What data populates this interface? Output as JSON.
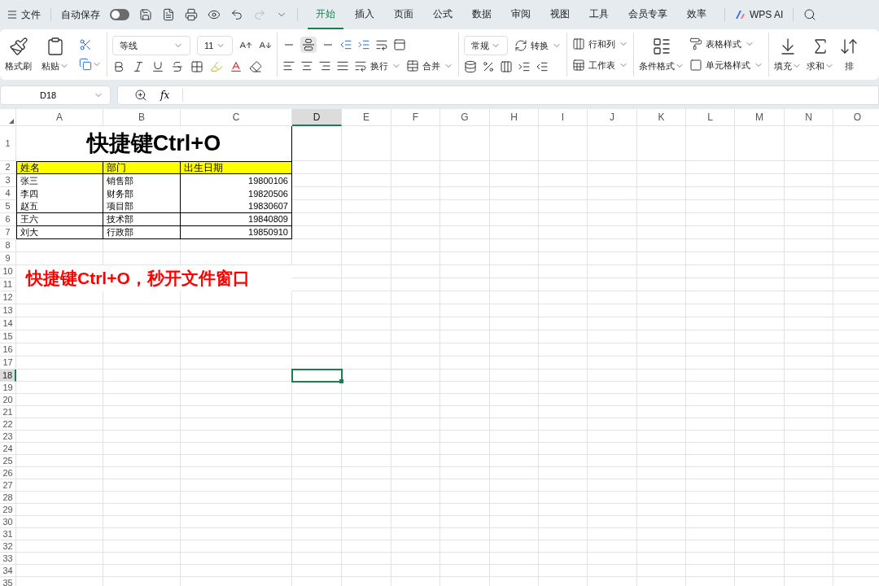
{
  "title_bar": {
    "file_menu": "文件",
    "autosave": {
      "label": "自动保存",
      "on": false
    },
    "tabs": [
      {
        "label": "开始",
        "selected": true
      },
      {
        "label": "插入",
        "selected": false
      },
      {
        "label": "页面",
        "selected": false
      },
      {
        "label": "公式",
        "selected": false
      },
      {
        "label": "数据",
        "selected": false
      },
      {
        "label": "审阅",
        "selected": false
      },
      {
        "label": "视图",
        "selected": false
      },
      {
        "label": "工具",
        "selected": false
      },
      {
        "label": "会员专享",
        "selected": false
      },
      {
        "label": "效率",
        "selected": false
      }
    ],
    "ai_button": "WPS AI"
  },
  "ribbon": {
    "format_painter": "格式刷",
    "paste": "粘贴",
    "font": "等线",
    "font_size": "11",
    "wrap": "换行",
    "merge": "合并",
    "number_format": "常规",
    "convert": "转换",
    "rows_cols": "行和列",
    "worksheet": "工作表",
    "conditional": "条件格式",
    "table_style": "表格样式",
    "cell_style": "单元格样式",
    "fill": "填充",
    "sum": "求和",
    "sort": "排"
  },
  "formula_bar": {
    "cell_name": "D18",
    "fx": "fx"
  },
  "columns": [
    {
      "label": "A",
      "selected": false
    },
    {
      "label": "B",
      "selected": false
    },
    {
      "label": "C",
      "selected": false
    },
    {
      "label": "D",
      "selected": true
    },
    {
      "label": "E",
      "selected": false
    },
    {
      "label": "F",
      "selected": false
    },
    {
      "label": "G",
      "selected": false
    },
    {
      "label": "H",
      "selected": false
    },
    {
      "label": "I",
      "selected": false
    },
    {
      "label": "J",
      "selected": false
    },
    {
      "label": "K",
      "selected": false
    },
    {
      "label": "L",
      "selected": false
    },
    {
      "label": "M",
      "selected": false
    },
    {
      "label": "N",
      "selected": false
    },
    {
      "label": "O",
      "selected": false
    }
  ],
  "rows": [
    {
      "label": "1",
      "selected": false
    },
    {
      "label": "2",
      "selected": false
    },
    {
      "label": "3",
      "selected": false
    },
    {
      "label": "4",
      "selected": false
    },
    {
      "label": "5",
      "selected": false
    },
    {
      "label": "6",
      "selected": false
    },
    {
      "label": "7",
      "selected": false
    },
    {
      "label": "8",
      "selected": false
    },
    {
      "label": "9",
      "selected": false
    },
    {
      "label": "10",
      "selected": false
    },
    {
      "label": "11",
      "selected": false
    },
    {
      "label": "12",
      "selected": false
    },
    {
      "label": "13",
      "selected": false
    },
    {
      "label": "14",
      "selected": false
    },
    {
      "label": "15",
      "selected": false
    },
    {
      "label": "16",
      "selected": false
    },
    {
      "label": "17",
      "selected": false
    },
    {
      "label": "18",
      "selected": true
    },
    {
      "label": "19",
      "selected": false
    },
    {
      "label": "20",
      "selected": false
    },
    {
      "label": "21",
      "selected": false
    },
    {
      "label": "22",
      "selected": false
    },
    {
      "label": "23",
      "selected": false
    },
    {
      "label": "24",
      "selected": false
    },
    {
      "label": "25",
      "selected": false
    },
    {
      "label": "26",
      "selected": false
    },
    {
      "label": "27",
      "selected": false
    },
    {
      "label": "28",
      "selected": false
    },
    {
      "label": "29",
      "selected": false
    },
    {
      "label": "30",
      "selected": false
    },
    {
      "label": "31",
      "selected": false
    },
    {
      "label": "32",
      "selected": false
    },
    {
      "label": "33",
      "selected": false
    },
    {
      "label": "34",
      "selected": false
    },
    {
      "label": "35",
      "selected": false
    }
  ],
  "sheet": {
    "title": "快捷键Ctrl+O",
    "header": [
      "姓名",
      "部门",
      "出生日期"
    ],
    "records": [
      {
        "name": "张三",
        "dept": "销售部",
        "birth": "19800106",
        "bottom_border": false
      },
      {
        "name": "李四",
        "dept": "财务部",
        "birth": "19820506",
        "bottom_border": false
      },
      {
        "name": "赵五",
        "dept": "项目部",
        "birth": "19830607",
        "bottom_border": true
      },
      {
        "name": "王六",
        "dept": "技术部",
        "birth": "19840809",
        "bottom_border": true
      },
      {
        "name": "刘大",
        "dept": "行政部",
        "birth": "19850910",
        "bottom_border": true
      }
    ],
    "note": "快捷键Ctrl+O，秒开文件窗口"
  }
}
